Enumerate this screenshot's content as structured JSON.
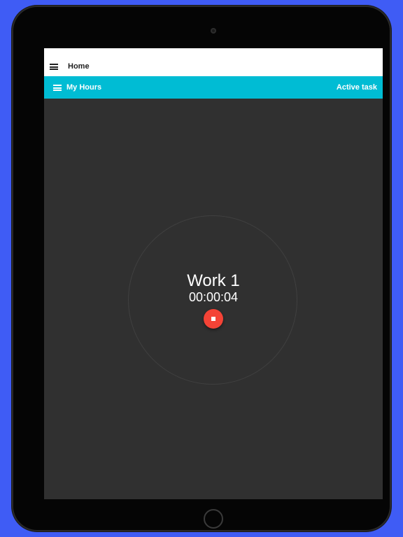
{
  "top_bar": {
    "title": "Home",
    "menu_icon": "menu-icon"
  },
  "app_bar": {
    "title": "My Hours",
    "action_label": "Active task",
    "menu_icon": "menu-icon",
    "color": "#00bcd4"
  },
  "task": {
    "name": "Work 1",
    "elapsed": "00:00:04"
  },
  "stop_button": {
    "icon": "stop-icon",
    "color": "#f44336"
  }
}
